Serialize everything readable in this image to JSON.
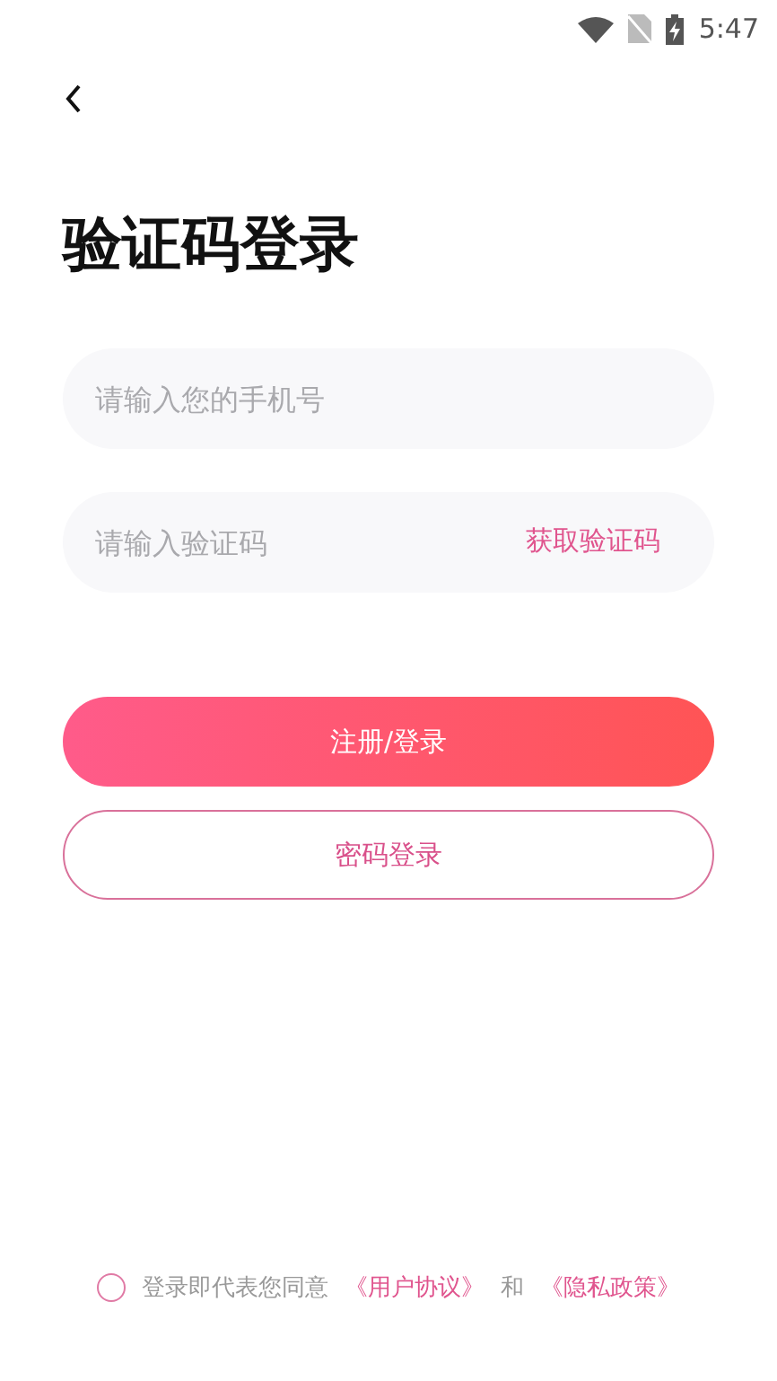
{
  "status_bar": {
    "time": "5:47"
  },
  "title": "验证码登录",
  "phone_field": {
    "placeholder": "请输入您的手机号"
  },
  "code_field": {
    "placeholder": "请输入验证码",
    "action": "获取验证码"
  },
  "buttons": [
    {
      "label": "注册/登录",
      "kind": "primary"
    },
    {
      "label": "密码登录",
      "kind": "outline"
    }
  ],
  "agreement": {
    "checked": false,
    "prefix": "登录即代表您同意",
    "links": [
      "《用户协议》",
      "《隐私政策》"
    ],
    "joiner": "和"
  }
}
